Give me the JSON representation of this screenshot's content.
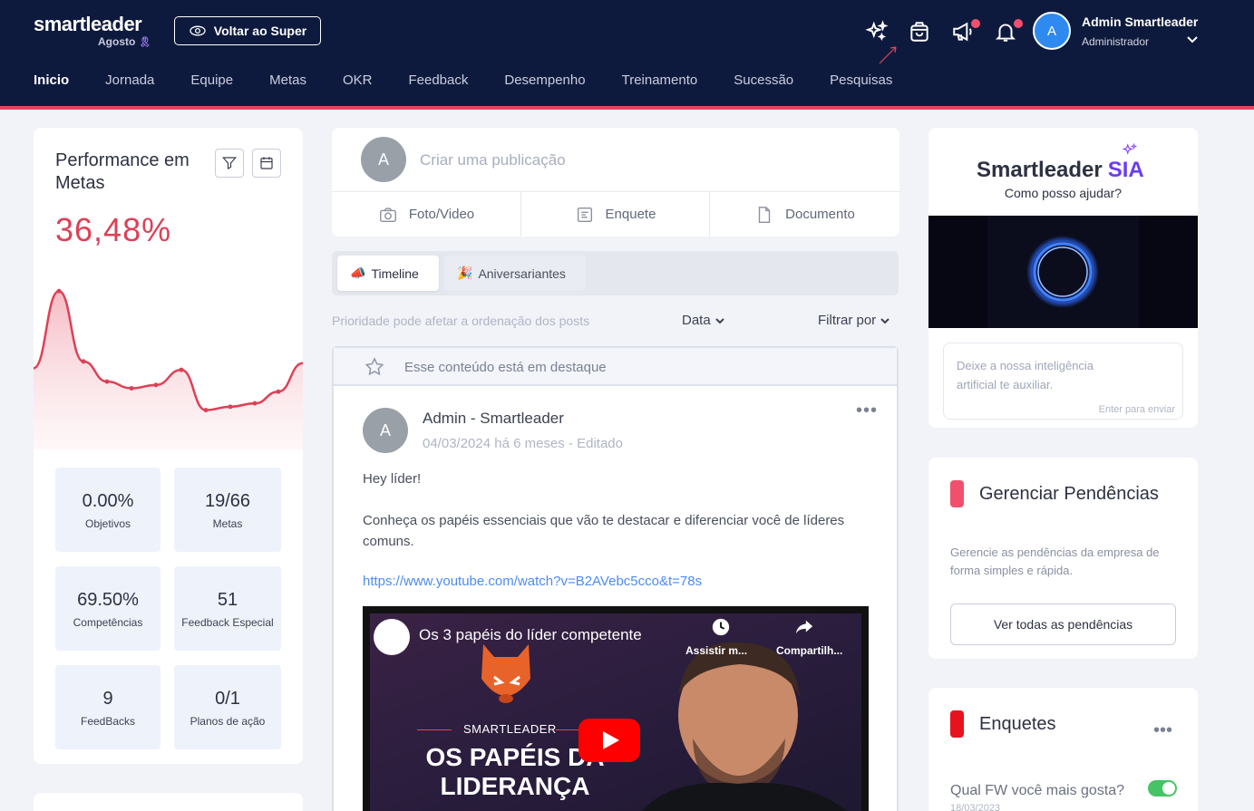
{
  "header": {
    "brand": "smartleader",
    "month": "Agosto",
    "voltar_label": "Voltar ao Super",
    "user": {
      "initial": "A",
      "name": "Admin Smartleader",
      "role": "Administrador"
    },
    "icons": [
      "sparkles-icon",
      "shopping-bag-icon",
      "megaphone-icon",
      "bell-icon"
    ],
    "nav": [
      {
        "label": "Inicio",
        "active": true
      },
      {
        "label": "Jornada"
      },
      {
        "label": "Equipe"
      },
      {
        "label": "Metas"
      },
      {
        "label": "OKR"
      },
      {
        "label": "Feedback"
      },
      {
        "label": "Desempenho"
      },
      {
        "label": "Treinamento"
      },
      {
        "label": "Sucessão"
      },
      {
        "label": "Pesquisas"
      }
    ]
  },
  "performance": {
    "title": "Performance em Metas",
    "value": "36,48%",
    "stats": [
      {
        "value": "0.00%",
        "label": "Objetivos"
      },
      {
        "value": "19/66",
        "label": "Metas"
      },
      {
        "value": "69.50%",
        "label": "Competências"
      },
      {
        "value": "51",
        "label": "Feedback Especial"
      },
      {
        "value": "9",
        "label": "FeedBacks"
      },
      {
        "value": "0/1",
        "label": "Planos de ação"
      }
    ]
  },
  "chart_data": {
    "type": "area",
    "values": [
      42,
      88,
      46,
      34,
      30,
      32,
      41,
      17,
      19,
      21,
      28,
      45
    ],
    "ylim": [
      0,
      100
    ],
    "color": "#dc4157"
  },
  "composer": {
    "avatar": "A",
    "placeholder": "Criar uma publicação",
    "options": [
      "Foto/Video",
      "Enquete",
      "Documento"
    ]
  },
  "tabs": [
    {
      "label": "Timeline",
      "active": true
    },
    {
      "label": "Aniversariantes"
    }
  ],
  "feed": {
    "priority_note": "Prioridade pode afetar a ordenação dos posts",
    "sort_label": "Data",
    "filter_label": "Filtrar por"
  },
  "post": {
    "featured_label": "Esse conteúdo está em destaque",
    "avatar": "A",
    "author": "Admin - Smartleader",
    "date": "04/03/2024 há 6 meses - Editado",
    "greeting": "Hey líder!",
    "body": "Conheça os papéis essenciais que vão te destacar e diferenciar você de líderes comuns.",
    "link": "https://www.youtube.com/watch?v=B2AVebc5cco&t=78s",
    "video": {
      "title": "Os 3 papéis do líder competente",
      "watch_later": "Assistir m...",
      "share": "Compartilh...",
      "brand": "SMARTLEADER",
      "headline": "OS PAPÉIS DA LIDERANÇA"
    }
  },
  "sia": {
    "title": "Smartleader",
    "title_accent": "SIA",
    "subtitle": "Como posso ajudar?",
    "input_placeholder": "Deixe a nossa inteligência artificial te auxiliar.",
    "enter_hint": "Enter para enviar"
  },
  "pendencias": {
    "title": "Gerenciar Pendências",
    "text": "Gerencie as pendências da empresa de forma simples e rápida.",
    "button": "Ver todas as pendências",
    "accent": "#f0506e"
  },
  "enquetes": {
    "title": "Enquetes",
    "question": "Qual FW você mais gosta?",
    "date": "18/03/2023",
    "accent": "#e8121f"
  }
}
